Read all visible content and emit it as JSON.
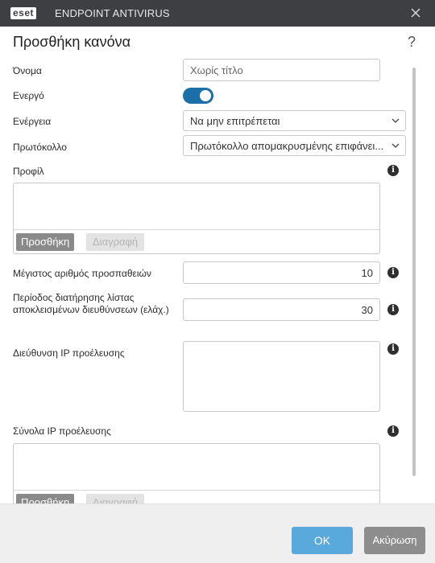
{
  "titlebar": {
    "logo_text": "eset",
    "app_title": "ENDPOINT ANTIVIRUS"
  },
  "dialog": {
    "heading": "Προσθήκη κανόνα",
    "help_glyph": "?"
  },
  "form": {
    "name": {
      "label": "Όνομα",
      "placeholder": "Χωρίς τίτλο"
    },
    "active": {
      "label": "Ενεργό",
      "enabled": true
    },
    "action": {
      "label": "Ενέργεια",
      "value": "Να μην επιτρέπεται"
    },
    "protocol": {
      "label": "Πρωτόκολλο",
      "value": "Πρωτόκολλο απομακρυσμένης επιφάνει..."
    },
    "profile": {
      "label": "Προφίλ",
      "add_label": "Προσθήκη",
      "delete_label": "Διαγραφή"
    },
    "max_attempts": {
      "label": "Μέγιστος αριθμός προσπαθειών",
      "value": "10"
    },
    "blacklist_retention": {
      "label": "Περίοδος διατήρησης λίστας αποκλεισμένων διευθύνσεων (ελάχ.)",
      "value": "30"
    },
    "source_ip": {
      "label": "Διεύθυνση IP προέλευσης"
    },
    "source_ip_sets": {
      "label": "Σύνολα IP προέλευσης",
      "add_label": "Προσθήκη",
      "delete_label": "Διαγραφή"
    }
  },
  "footer": {
    "ok_label": "OK",
    "cancel_label": "Ακύρωση"
  },
  "icons": {
    "info": "info-icon",
    "close": "close-icon",
    "chevron": "chevron-down-icon",
    "help": "help-icon"
  },
  "colors": {
    "titlebar_bg": "#3d3f42",
    "toggle_on": "#1a6fa8",
    "ok_button": "#59a9dc",
    "cancel_button": "#8d8d8d",
    "add_button": "#8a8a8a"
  }
}
